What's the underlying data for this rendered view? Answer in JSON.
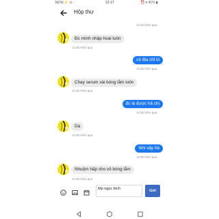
{
  "status": {
    "left": "3d/3d ⚡ ⊙ ·",
    "time": "12:17",
    "right": "⏰ ▾ 41% ▮"
  },
  "header": {
    "title": "Hộp thư"
  },
  "messages": [
    {
      "dir": "in",
      "text": "Đc mình nhập hoài luôn",
      "time": "14:35 Hôm qua"
    },
    {
      "dir": "out",
      "text": "có địa chỉ ủi",
      "time": "14:35 Hôm qua"
    },
    {
      "dir": "in",
      "text": "Chay serum xài bóng lắm luôn",
      "time": "14:35 Hôm qua"
    },
    {
      "dir": "out",
      "text": "đc là được hả chị",
      "time": "14:35 Hôm qua"
    },
    {
      "dir": "in",
      "text": "Dạ",
      "time": "14:35 Hôm qua"
    },
    {
      "dir": "out",
      "text": "hihi vậy hả",
      "time": "14:35 Hôm qua"
    },
    {
      "dir": "in",
      "text": "Nhuộm hấp cho vô bóng lắm",
      "time": "14:36 Hôm qua"
    }
  ],
  "top_stamp": "14:34 Hôm qua",
  "composer": {
    "input_value": "Mp ngọc bích",
    "send_label": "Gửi",
    "icons": [
      "emoji-icon",
      "image-icon",
      "calendar-icon"
    ]
  },
  "colors": {
    "outgoing_bubble": "#1e78f0",
    "incoming_bubble": "#ebebeb",
    "send_button": "#3d6bc4"
  }
}
